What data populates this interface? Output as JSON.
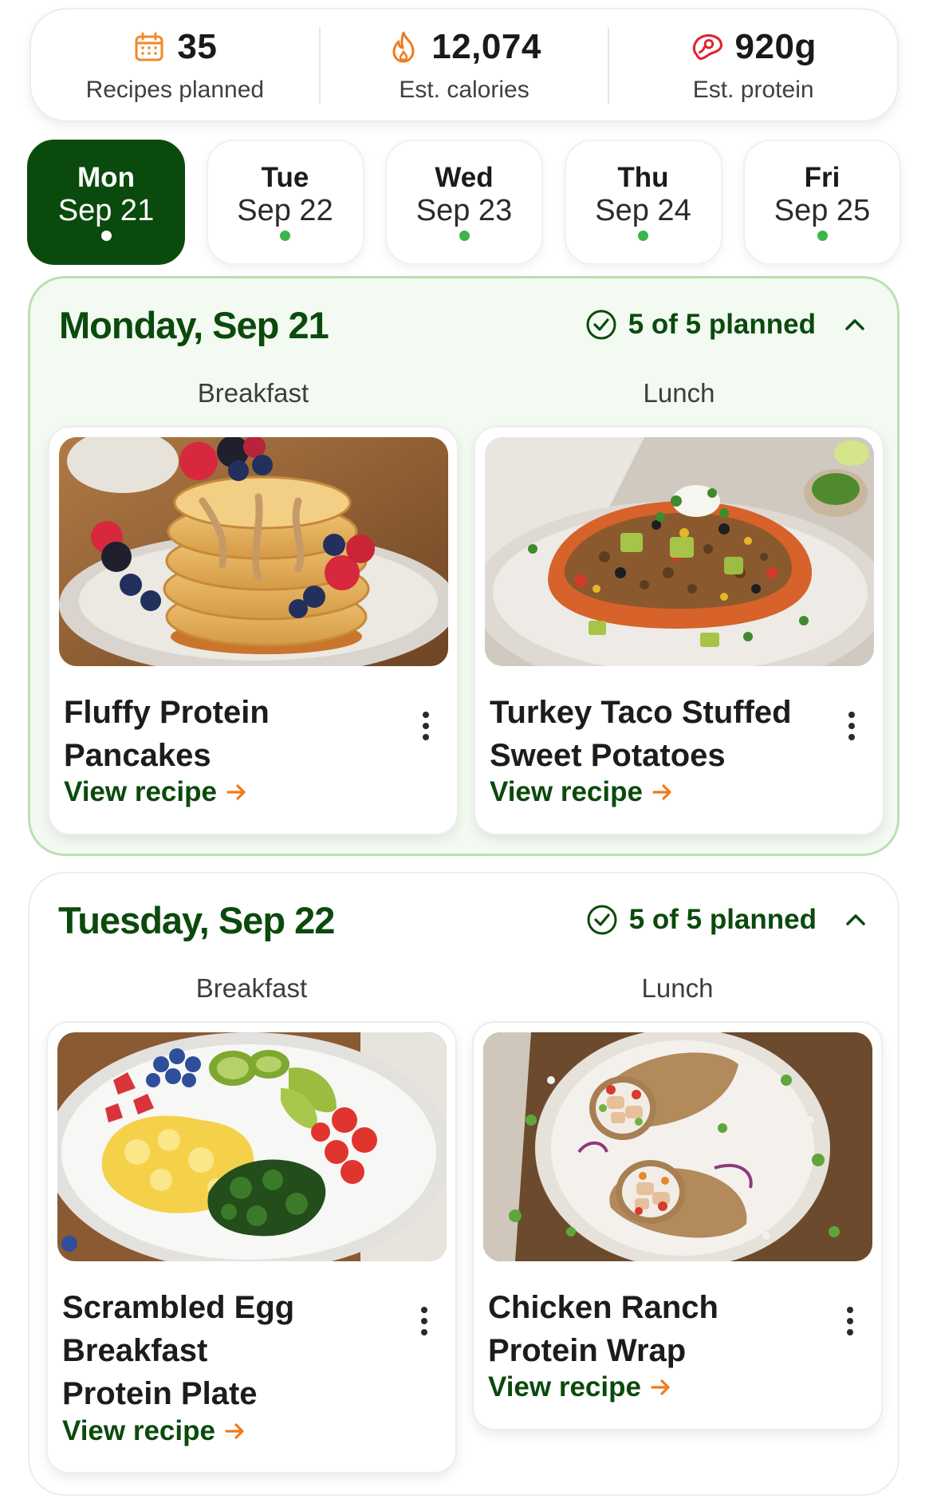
{
  "stats": [
    {
      "icon": "calendar-icon",
      "value": "35",
      "label": "Recipes planned"
    },
    {
      "icon": "flame-icon",
      "value": "12,074",
      "label": "Est. calories"
    },
    {
      "icon": "steak-icon",
      "value": "920g",
      "label": "Est. protein"
    }
  ],
  "days": [
    {
      "name": "Mon",
      "date": "Sep 21",
      "active": true
    },
    {
      "name": "Tue",
      "date": "Sep 22",
      "active": false
    },
    {
      "name": "Wed",
      "date": "Sep 23",
      "active": false
    },
    {
      "name": "Thu",
      "date": "Sep 24",
      "active": false
    },
    {
      "name": "Fri",
      "date": "Sep 25",
      "active": false
    }
  ],
  "sections": [
    {
      "title": "Monday, Sep 21",
      "status": "5 of 5 planned",
      "meals": [
        {
          "label": "Breakfast",
          "recipe": "Fluffy Protein Pancakes",
          "link": "View recipe"
        },
        {
          "label": "Lunch",
          "recipe": "Turkey Taco Stuffed Sweet Potatoes",
          "link": "View recipe"
        }
      ]
    },
    {
      "title": "Tuesday, Sep 22",
      "status": "5 of 5 planned",
      "meals": [
        {
          "label": "Breakfast",
          "recipe": "Scrambled Egg Breakfast Protein Plate",
          "link": "View recipe"
        },
        {
          "label": "Lunch",
          "recipe": "Chicken Ranch Protein Wrap",
          "link": "View recipe"
        }
      ]
    }
  ],
  "colors": {
    "brand_green": "#0b4a0d",
    "accent_dot": "#3bb54a",
    "active_section_bg": "#f3faf1",
    "flame_orange": "#f07a1c",
    "steak_red": "#e0222f"
  }
}
